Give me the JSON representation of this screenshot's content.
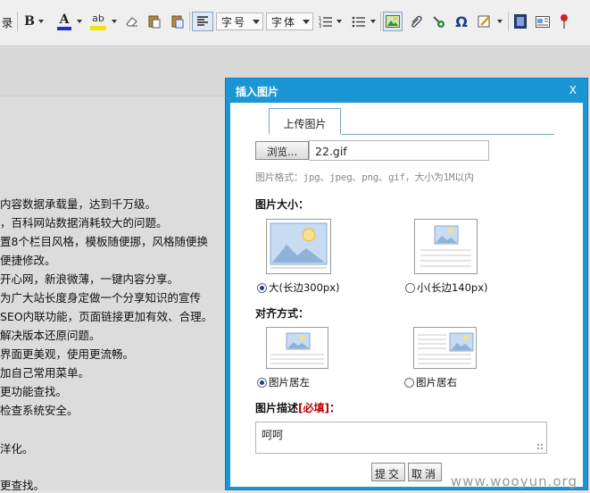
{
  "toolbar": {
    "partial_label": "录",
    "bold_label": "B",
    "fontcolor_label": "A",
    "highlight_label": "ab",
    "heading_select": "字号",
    "font_select": "字体",
    "omega_label": "Ω"
  },
  "editor": {
    "lines": [
      "内容数据承载量，达到千万级。",
      "，百科网站数据消耗较大的问题。",
      "置8个栏目风格，模板随便挪，风格随便换",
      "便捷修改。",
      "开心网，新浪微薄，一键内容分享。",
      "为广大站长度身定做一个分享知识的宣传",
      "SEO内联功能，页面链接更加有效、合理。",
      "解决版本还原问题。",
      "界面更美观，使用更流畅。",
      "加自己常用菜单。",
      "更功能查找。",
      "检查系统安全。",
      "洋化。",
      "更查找。"
    ]
  },
  "dialog": {
    "title": "插入图片",
    "close": "X",
    "tab_upload": "上传图片",
    "browse_button": "浏览...",
    "file_name": "22.gif",
    "format_hint": "图片格式：jpg、jpeg、png、gif，大小为1M以内",
    "size_label": "图片大小：",
    "size_large": "大(长边300px)",
    "size_small": "小(长边140px)",
    "align_label": "对齐方式：",
    "align_left": "图片居左",
    "align_right": "图片居右",
    "desc_label": "图片描述",
    "desc_required": "[必填]",
    "desc_colon": "：",
    "desc_value": "呵呵",
    "submit": "提交",
    "cancel": "取消"
  },
  "watermark": "www.wooyun.org",
  "colors": {
    "dialog_blue": "#1b96d4",
    "required_red": "#c00000",
    "fontcolor_bar": "#1f2fd0",
    "highlight_bar": "#f2e400"
  }
}
